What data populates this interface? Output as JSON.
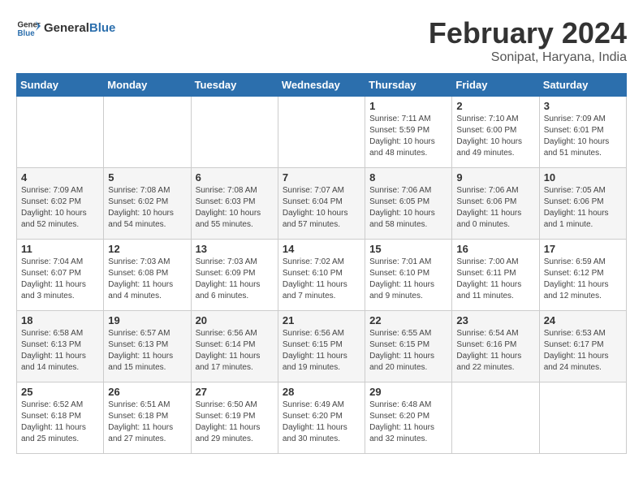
{
  "header": {
    "logo_text_general": "General",
    "logo_text_blue": "Blue",
    "title": "February 2024",
    "subtitle": "Sonipat, Haryana, India"
  },
  "days_of_week": [
    "Sunday",
    "Monday",
    "Tuesday",
    "Wednesday",
    "Thursday",
    "Friday",
    "Saturday"
  ],
  "weeks": [
    [
      {
        "day": "",
        "content": ""
      },
      {
        "day": "",
        "content": ""
      },
      {
        "day": "",
        "content": ""
      },
      {
        "day": "",
        "content": ""
      },
      {
        "day": "1",
        "content": "Sunrise: 7:11 AM\nSunset: 5:59 PM\nDaylight: 10 hours\nand 48 minutes."
      },
      {
        "day": "2",
        "content": "Sunrise: 7:10 AM\nSunset: 6:00 PM\nDaylight: 10 hours\nand 49 minutes."
      },
      {
        "day": "3",
        "content": "Sunrise: 7:09 AM\nSunset: 6:01 PM\nDaylight: 10 hours\nand 51 minutes."
      }
    ],
    [
      {
        "day": "4",
        "content": "Sunrise: 7:09 AM\nSunset: 6:02 PM\nDaylight: 10 hours\nand 52 minutes."
      },
      {
        "day": "5",
        "content": "Sunrise: 7:08 AM\nSunset: 6:02 PM\nDaylight: 10 hours\nand 54 minutes."
      },
      {
        "day": "6",
        "content": "Sunrise: 7:08 AM\nSunset: 6:03 PM\nDaylight: 10 hours\nand 55 minutes."
      },
      {
        "day": "7",
        "content": "Sunrise: 7:07 AM\nSunset: 6:04 PM\nDaylight: 10 hours\nand 57 minutes."
      },
      {
        "day": "8",
        "content": "Sunrise: 7:06 AM\nSunset: 6:05 PM\nDaylight: 10 hours\nand 58 minutes."
      },
      {
        "day": "9",
        "content": "Sunrise: 7:06 AM\nSunset: 6:06 PM\nDaylight: 11 hours\nand 0 minutes."
      },
      {
        "day": "10",
        "content": "Sunrise: 7:05 AM\nSunset: 6:06 PM\nDaylight: 11 hours\nand 1 minute."
      }
    ],
    [
      {
        "day": "11",
        "content": "Sunrise: 7:04 AM\nSunset: 6:07 PM\nDaylight: 11 hours\nand 3 minutes."
      },
      {
        "day": "12",
        "content": "Sunrise: 7:03 AM\nSunset: 6:08 PM\nDaylight: 11 hours\nand 4 minutes."
      },
      {
        "day": "13",
        "content": "Sunrise: 7:03 AM\nSunset: 6:09 PM\nDaylight: 11 hours\nand 6 minutes."
      },
      {
        "day": "14",
        "content": "Sunrise: 7:02 AM\nSunset: 6:10 PM\nDaylight: 11 hours\nand 7 minutes."
      },
      {
        "day": "15",
        "content": "Sunrise: 7:01 AM\nSunset: 6:10 PM\nDaylight: 11 hours\nand 9 minutes."
      },
      {
        "day": "16",
        "content": "Sunrise: 7:00 AM\nSunset: 6:11 PM\nDaylight: 11 hours\nand 11 minutes."
      },
      {
        "day": "17",
        "content": "Sunrise: 6:59 AM\nSunset: 6:12 PM\nDaylight: 11 hours\nand 12 minutes."
      }
    ],
    [
      {
        "day": "18",
        "content": "Sunrise: 6:58 AM\nSunset: 6:13 PM\nDaylight: 11 hours\nand 14 minutes."
      },
      {
        "day": "19",
        "content": "Sunrise: 6:57 AM\nSunset: 6:13 PM\nDaylight: 11 hours\nand 15 minutes."
      },
      {
        "day": "20",
        "content": "Sunrise: 6:56 AM\nSunset: 6:14 PM\nDaylight: 11 hours\nand 17 minutes."
      },
      {
        "day": "21",
        "content": "Sunrise: 6:56 AM\nSunset: 6:15 PM\nDaylight: 11 hours\nand 19 minutes."
      },
      {
        "day": "22",
        "content": "Sunrise: 6:55 AM\nSunset: 6:15 PM\nDaylight: 11 hours\nand 20 minutes."
      },
      {
        "day": "23",
        "content": "Sunrise: 6:54 AM\nSunset: 6:16 PM\nDaylight: 11 hours\nand 22 minutes."
      },
      {
        "day": "24",
        "content": "Sunrise: 6:53 AM\nSunset: 6:17 PM\nDaylight: 11 hours\nand 24 minutes."
      }
    ],
    [
      {
        "day": "25",
        "content": "Sunrise: 6:52 AM\nSunset: 6:18 PM\nDaylight: 11 hours\nand 25 minutes."
      },
      {
        "day": "26",
        "content": "Sunrise: 6:51 AM\nSunset: 6:18 PM\nDaylight: 11 hours\nand 27 minutes."
      },
      {
        "day": "27",
        "content": "Sunrise: 6:50 AM\nSunset: 6:19 PM\nDaylight: 11 hours\nand 29 minutes."
      },
      {
        "day": "28",
        "content": "Sunrise: 6:49 AM\nSunset: 6:20 PM\nDaylight: 11 hours\nand 30 minutes."
      },
      {
        "day": "29",
        "content": "Sunrise: 6:48 AM\nSunset: 6:20 PM\nDaylight: 11 hours\nand 32 minutes."
      },
      {
        "day": "",
        "content": ""
      },
      {
        "day": "",
        "content": ""
      }
    ]
  ]
}
